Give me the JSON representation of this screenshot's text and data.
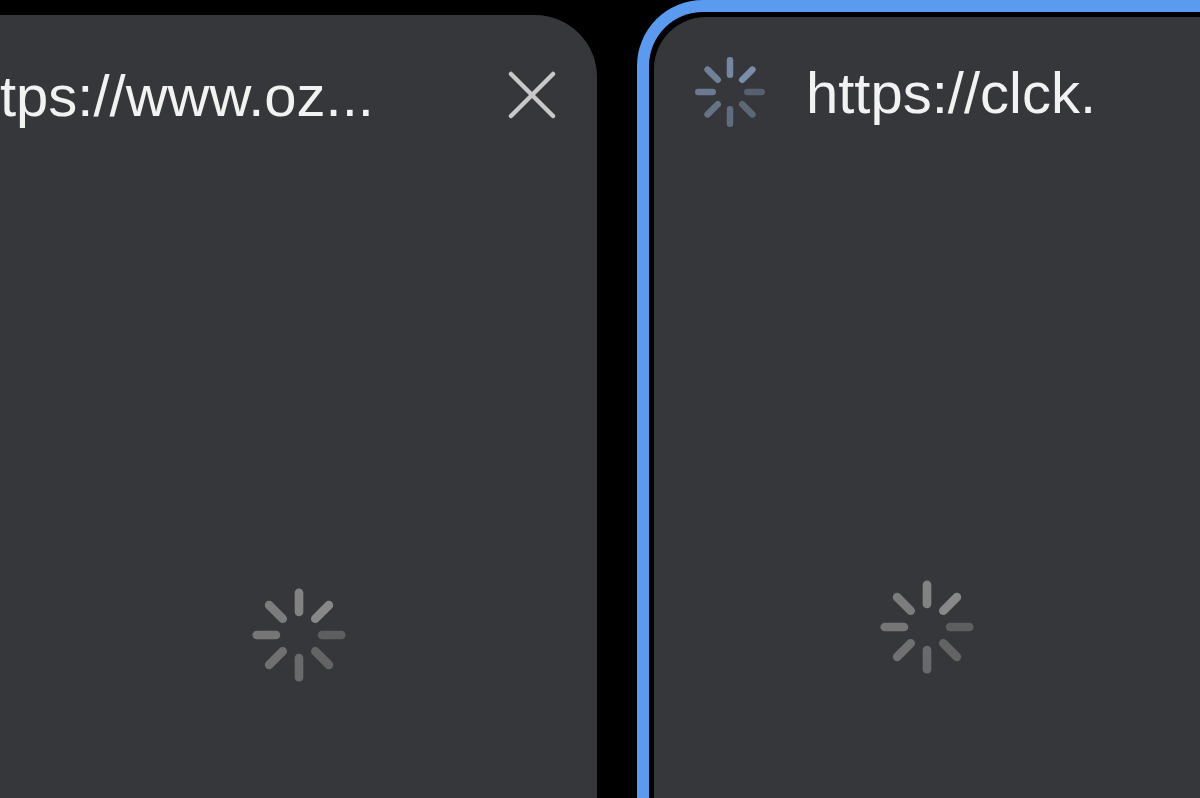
{
  "tabs": [
    {
      "title": "tps://www.oz...",
      "selected": false,
      "favicon": false,
      "close_button": true,
      "loading": true
    },
    {
      "title": "https://clck.",
      "selected": true,
      "favicon": true,
      "close_button": false,
      "loading": true
    }
  ]
}
